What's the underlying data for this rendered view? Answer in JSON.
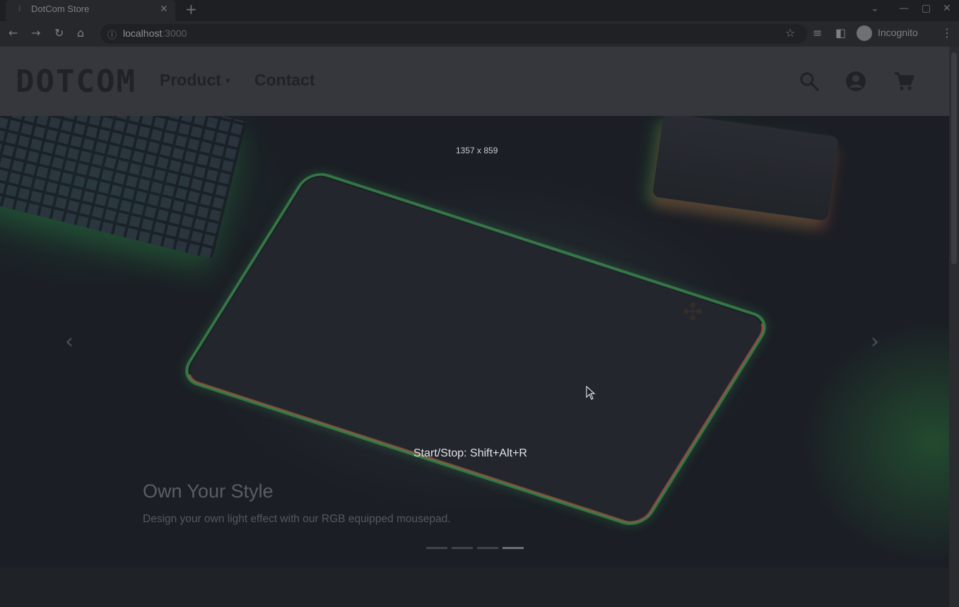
{
  "browser": {
    "tab_title": "DotCom Store",
    "tab_favicon": "favicon-icon",
    "url_host": "localhost",
    "url_port": ":3000",
    "profile_label": "Incognito"
  },
  "site": {
    "logo": "DOTCOM",
    "nav": {
      "product": "Product",
      "contact": "Contact"
    }
  },
  "carousel": {
    "slide_count": 4,
    "active_index": 3,
    "caption_title": "Own Your Style",
    "caption_text": "Design your own light effect with our RGB equipped mousepad."
  },
  "overlay": {
    "dimensions": "1357 x 859",
    "hint": "Start/Stop: Shift+Alt+R"
  },
  "colors": {
    "header": "#35373c",
    "hero_dark": "#1b1f25",
    "rgb_green": "#46aa5a",
    "rgb_red": "#c85a50"
  }
}
